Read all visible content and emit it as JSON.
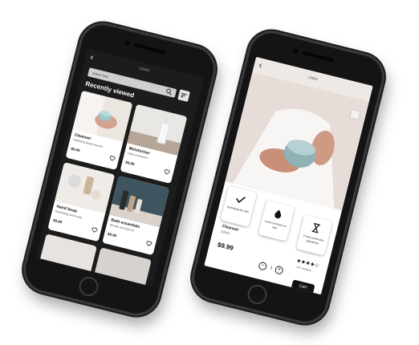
{
  "left_screen": {
    "logo": "LOGO",
    "back_icon": "chevron-left",
    "search": {
      "placeholder": "search here"
    },
    "title": "Recently viewed",
    "products": [
      {
        "name": "Cleanser",
        "desc": "Hydrating facial cleanser",
        "price": "$9.99"
      },
      {
        "name": "Moisturizer",
        "desc": "Daily moisturizer",
        "price": "$9.99"
      },
      {
        "name": "Hand Soap",
        "desc": "Nourishing hand soap",
        "price": "$9.99"
      },
      {
        "name": "Bath essentials",
        "desc": "Shower and bath kit",
        "price": "$9.99"
      }
    ]
  },
  "right_screen": {
    "logo": "LOGO",
    "back_icon": "chevron-left",
    "features": [
      {
        "icon": "check-icon",
        "text": "Hydrating dry skin"
      },
      {
        "icon": "drop-icon",
        "text": "Locks moisture on skin"
      },
      {
        "icon": "hourglass-icon",
        "text": "2-hour protection guarantee"
      }
    ],
    "product": {
      "name": "Cleanser",
      "size": "200ml",
      "price": "$9.99",
      "rating_stars": "★★★★☆",
      "reviews": "147 reviews",
      "quantity": "1",
      "cart_label": "Cart"
    }
  },
  "colors": {
    "screen_bg": "#1c1c1c",
    "accent": "#111111"
  }
}
